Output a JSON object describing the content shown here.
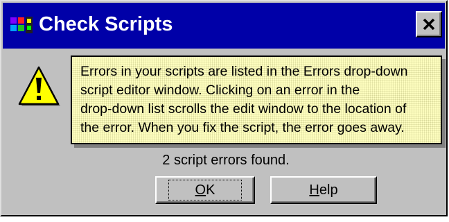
{
  "dialog": {
    "title": "Check Scripts",
    "icons": {
      "app": "check-scripts-app-icon",
      "close": "close-icon",
      "message": "warning-icon"
    },
    "message_lines": [
      "Errors in your scripts are listed in the Errors drop-down",
      "script editor window.  Clicking on an error in the",
      "drop-down list scrolls the edit window to the location of",
      "the error.  When you fix the script, the error goes away."
    ],
    "status": "2 script errors found.",
    "buttons": {
      "ok": {
        "mnemonic": "O",
        "rest": "K"
      },
      "help": {
        "mnemonic": "H",
        "rest": "elp"
      }
    }
  },
  "colors": {
    "titlebar": "#0000a8",
    "dialog_bg": "#c0c0c0",
    "tip_bg": "#ffffc0",
    "warning_fill": "#ffff00"
  }
}
